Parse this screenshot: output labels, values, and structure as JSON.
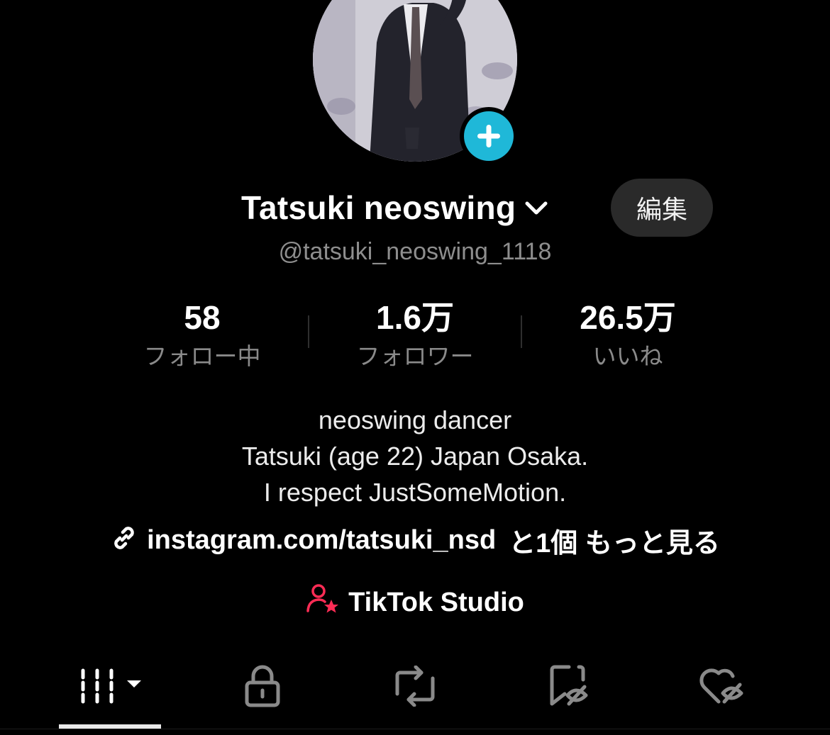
{
  "profile": {
    "display_name": "Tatsuki neoswing",
    "handle": "@tatsuki_neoswing_1118",
    "edit_label": "編集",
    "avatar_add_icon": "plus-icon"
  },
  "stats": [
    {
      "value": "58",
      "label": "フォロー中"
    },
    {
      "value": "1.6万",
      "label": "フォロワー"
    },
    {
      "value": "26.5万",
      "label": "いいね"
    }
  ],
  "bio": {
    "line1": "neoswing dancer",
    "line2": "Tatsuki (age 22) Japan Osaka.",
    "line3": "I respect JustSomeMotion."
  },
  "link": {
    "url": "instagram.com/tatsuki_nsd",
    "more": "と1個 もっと見る",
    "icon": "link-icon"
  },
  "studio": {
    "label": "TikTok Studio",
    "icon": "user-star-icon"
  },
  "tabs": [
    {
      "icon": "videos-grid-icon",
      "selected": true
    },
    {
      "icon": "lock-icon",
      "selected": false
    },
    {
      "icon": "repost-icon",
      "selected": false
    },
    {
      "icon": "bookmark-hidden-icon",
      "selected": false
    },
    {
      "icon": "heart-hidden-icon",
      "selected": false
    }
  ],
  "colors": {
    "accent_blue": "#1fb8d8",
    "studio_red": "#fe2c55",
    "muted_text": "#8e8e8e"
  }
}
